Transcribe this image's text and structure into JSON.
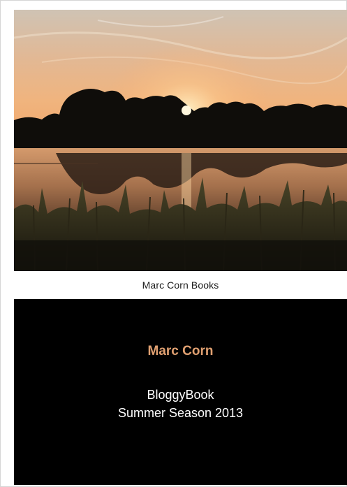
{
  "cover": {
    "publisher": "Marc Corn Books",
    "author": "Marc Corn",
    "title": "BloggyBook",
    "subtitle": "Summer Season 2013"
  },
  "colors": {
    "author_text": "#e0a071",
    "title_text": "#ffffff",
    "title_block_bg": "#000000",
    "publisher_text": "#1a1a1a"
  },
  "photo": {
    "subject": "sunset-over-lake-with-trees-and-reeds"
  }
}
